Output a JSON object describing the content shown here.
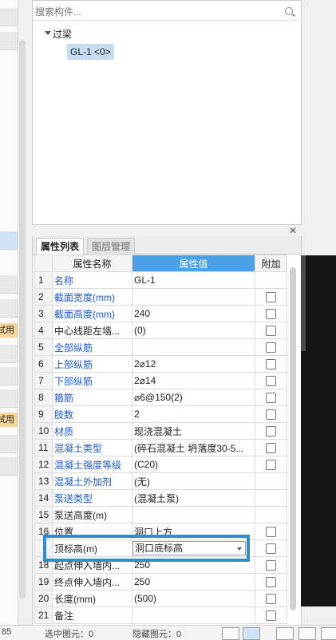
{
  "left_strip": {
    "tag_text": "試用"
  },
  "search": {
    "placeholder": "搜索构件..."
  },
  "tree": {
    "root_label": "过梁",
    "child_label": "GL-1 <0>"
  },
  "tabs": {
    "attr": "属性列表",
    "layer": "图层管理"
  },
  "table": {
    "headers": {
      "name": "属性名称",
      "value": "属性值",
      "add": "附加"
    },
    "rows": [
      {
        "num": "1",
        "name": "名称",
        "value": "GL-1",
        "blue": true,
        "check": false
      },
      {
        "num": "2",
        "name": "截面宽度(mm)",
        "value": "",
        "blue": true,
        "check": true
      },
      {
        "num": "3",
        "name": "截面高度(mm)",
        "value": "240",
        "blue": true,
        "check": true
      },
      {
        "num": "4",
        "name": "中心线距左墙...",
        "value": "(0)",
        "blue": false,
        "check": true
      },
      {
        "num": "5",
        "name": "全部纵筋",
        "value": "",
        "blue": true,
        "check": true
      },
      {
        "num": "6",
        "name": "上部纵筋",
        "value": "2⌀12",
        "blue": true,
        "check": true
      },
      {
        "num": "7",
        "name": "下部纵筋",
        "value": "2⌀14",
        "blue": true,
        "check": true
      },
      {
        "num": "8",
        "name": "箍筋",
        "value": "⌀6@150(2)",
        "blue": true,
        "check": true
      },
      {
        "num": "9",
        "name": "肢数",
        "value": "2",
        "blue": true,
        "check": true
      },
      {
        "num": "10",
        "name": "材质",
        "value": "现浇混凝土",
        "blue": true,
        "check": true
      },
      {
        "num": "11",
        "name": "混凝土类型",
        "value": "(碎石混凝土 坍落度30-5...",
        "blue": true,
        "check": true
      },
      {
        "num": "12",
        "name": "混凝土强度等级",
        "value": "(C20)",
        "blue": true,
        "check": true
      },
      {
        "num": "13",
        "name": "混凝土外加剂",
        "value": "(无)",
        "blue": true,
        "check": false
      },
      {
        "num": "14",
        "name": "泵送类型",
        "value": "(混凝土泵)",
        "blue": true,
        "check": false
      },
      {
        "num": "15",
        "name": "泵送高度(m)",
        "value": "",
        "blue": false,
        "check": false
      },
      {
        "num": "16",
        "name": "位置",
        "value": "洞口上方",
        "blue": false,
        "check": true
      },
      {
        "num": "17",
        "name": "顶标高(m)",
        "value": "",
        "blue": false,
        "check": true
      },
      {
        "num": "18",
        "name": "起点伸入墙内...",
        "value": "250",
        "blue": false,
        "check": true
      },
      {
        "num": "19",
        "name": "终点伸入墙内...",
        "value": "250",
        "blue": false,
        "check": true
      },
      {
        "num": "20",
        "name": "长度(mm)",
        "value": "(500)",
        "blue": false,
        "check": true
      },
      {
        "num": "21",
        "name": "备注",
        "value": "",
        "blue": false,
        "check": true
      }
    ]
  },
  "editor": {
    "value": "洞口底标高"
  },
  "bottom": {
    "num": "85",
    "selected": "选中图元：0",
    "hidden": "隐藏图元：0"
  }
}
